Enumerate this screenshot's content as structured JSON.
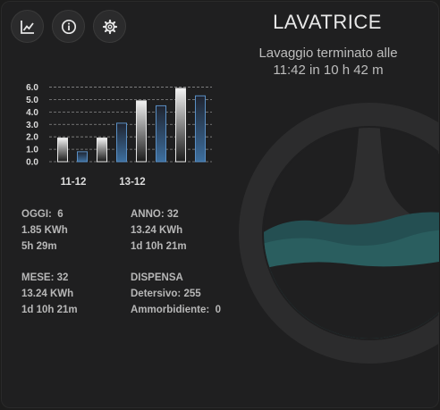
{
  "toolbar": {
    "buttons": [
      {
        "icon": "chart-line-icon"
      },
      {
        "icon": "info-icon"
      },
      {
        "icon": "gear-icon"
      }
    ]
  },
  "title": "LAVATRICE",
  "status_line1": "Lavaggio terminato alle",
  "status_line2": "11:42 in 10 h 42 m",
  "colors": {
    "white_bar": "#f2f2f2",
    "blue_bar": "#3d6f9f",
    "water": "#285a5a",
    "background": "#1f1f20"
  },
  "chart_data": {
    "type": "bar",
    "y_ticks": [
      "6.0",
      "5.0",
      "4.0",
      "3.0",
      "2.0",
      "1.0",
      "0.0"
    ],
    "ylim": [
      0,
      6.4
    ],
    "grid": true,
    "x_labels": [
      {
        "label": "11-12",
        "slot": 1
      },
      {
        "label": "13-12",
        "slot": 4
      }
    ],
    "series": [
      {
        "color": "white",
        "values": [
          1.9,
          0.0,
          1.9,
          0.0,
          4.9,
          0.0,
          5.9,
          0.0
        ]
      },
      {
        "color": "blue",
        "values": [
          0.0,
          0.8,
          0.0,
          3.1,
          0.0,
          4.5,
          0.0,
          5.3
        ]
      }
    ]
  },
  "stats": {
    "oggi": {
      "label": "OGGI:",
      "value": "6",
      "energy": "1.85 KWh",
      "time": "5h 29m"
    },
    "anno": {
      "label": "ANNO:",
      "value": "32",
      "energy": "13.24 KWh",
      "time": "1d 10h 21m"
    },
    "mese": {
      "label": "MESE:",
      "value": "32",
      "energy": "13.24 KWh",
      "time": "1d 10h 21m"
    },
    "dispensa": {
      "label": "DISPENSA",
      "detersivo_label": "Detersivo:",
      "detersivo_value": "255",
      "ammorbidente_label": "Ammorbidiente:",
      "ammorbidente_value": "0"
    }
  }
}
